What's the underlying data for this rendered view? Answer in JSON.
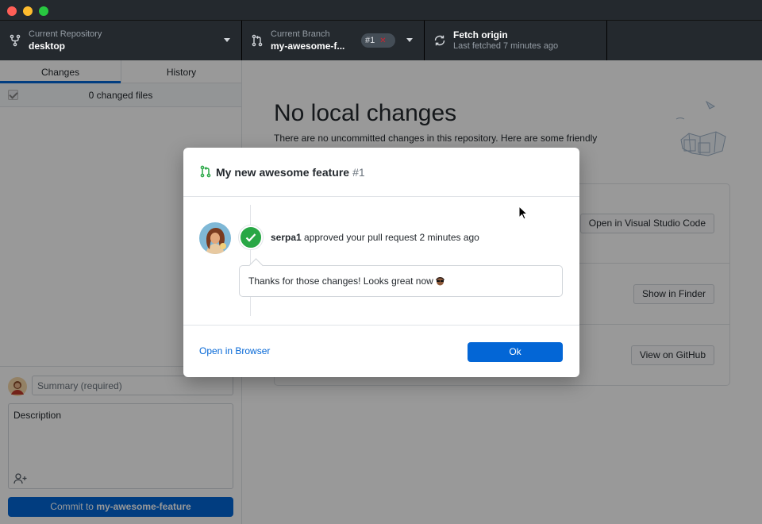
{
  "toolbar": {
    "repository": {
      "label": "Current Repository",
      "value": "desktop",
      "icon": "repo-icon"
    },
    "branch": {
      "label": "Current Branch",
      "value": "my-awesome-f...",
      "pr_badge": "#1",
      "pr_status_icon": "x-icon",
      "icon": "git-pull-request-icon"
    },
    "fetch": {
      "label": "Fetch origin",
      "value": "Last fetched 7 minutes ago",
      "icon": "sync-icon"
    }
  },
  "sidebar": {
    "tabs": [
      {
        "label": "Changes",
        "selected": true
      },
      {
        "label": "History",
        "selected": false
      }
    ],
    "changed_files": "0 changed files",
    "commit": {
      "summary_placeholder": "Summary (required)",
      "description_placeholder": "Description",
      "button_prefix": "Commit to ",
      "button_branch": "my-awesome-feature"
    }
  },
  "main": {
    "title": "No local changes",
    "subtitle": "There are no uncommitted changes in this repository. Here are some friendly",
    "actions": [
      {
        "button": "Open in Visual Studio Code"
      },
      {
        "button": "Show in Finder"
      },
      {
        "button": "View on GitHub"
      }
    ]
  },
  "dialog": {
    "title": "My new awesome feature",
    "number": "#1",
    "reviewer": "serpa1",
    "approval_text": " approved your pull request 2 minutes ago",
    "comment": "Thanks for those changes! Looks great now",
    "open_browser": "Open in Browser",
    "ok": "Ok"
  },
  "colors": {
    "accent": "#0366d6",
    "approved": "#28a745",
    "toolbar": "#24292e"
  }
}
